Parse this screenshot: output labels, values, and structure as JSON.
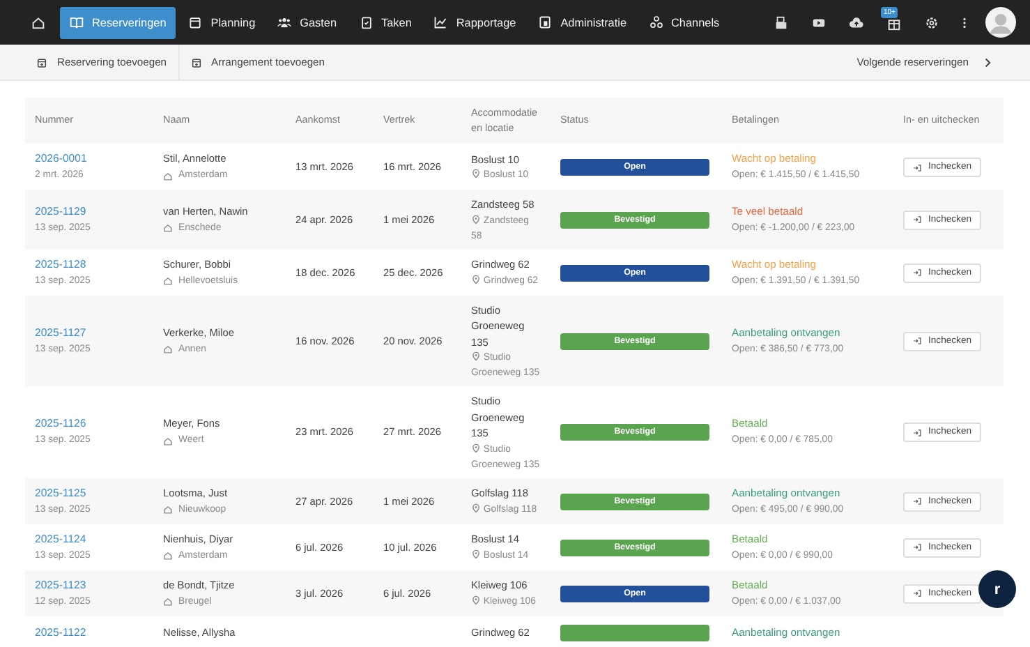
{
  "nav": {
    "items": [
      {
        "label": "Reserveringen",
        "selected": true
      },
      {
        "label": "Planning",
        "selected": false
      },
      {
        "label": "Gasten",
        "selected": false
      },
      {
        "label": "Taken",
        "selected": false
      },
      {
        "label": "Rapportage",
        "selected": false
      },
      {
        "label": "Administratie",
        "selected": false
      },
      {
        "label": "Channels",
        "selected": false
      }
    ],
    "badge": "10+"
  },
  "toolbar": {
    "actions": [
      "Reservering toevoegen",
      "Arrangement toevoegen"
    ],
    "next": "Volgende reserveringen"
  },
  "table": {
    "columns": [
      "Nummer",
      "Naam",
      "Aankomst",
      "Vertrek",
      "Accommodatie en locatie",
      "Status",
      "Betalingen",
      "In- en uitchecken"
    ],
    "rows": [
      {
        "number": "2026-0001",
        "date": "2 mrt. 2026",
        "name": "Stil, Annelotte",
        "city": "Amsterdam",
        "arrival": "13 mrt. 2026",
        "departure": "16 mrt. 2026",
        "accommodation": "Boslust 10",
        "location": "Boslust 10",
        "status": {
          "kind": "open",
          "label": "Open"
        },
        "payment": {
          "kind": "waiting",
          "label": "Wacht op betaling",
          "detail": "Open: € 1.415,50 / € 1.415,50"
        },
        "action": "Inchecken"
      },
      {
        "number": "2025-1129",
        "date": "13 sep. 2025",
        "name": "van Herten, Nawin",
        "city": "Enschede",
        "arrival": "24 apr. 2026",
        "departure": "1 mei 2026",
        "accommodation": "Zandsteeg 58",
        "location": "Zandsteeg 58",
        "status": {
          "kind": "confirmed",
          "label": "Bevestigd"
        },
        "payment": {
          "kind": "overpaid",
          "label": "Te veel betaald",
          "detail": "Open: € -1.200,00 / € 223,00"
        },
        "action": "Inchecken"
      },
      {
        "number": "2025-1128",
        "date": "13 sep. 2025",
        "name": "Schurer, Bobbi",
        "city": "Hellevoetsluis",
        "arrival": "18 dec. 2026",
        "departure": "25 dec. 2026",
        "accommodation": "Grindweg 62",
        "location": "Grindweg 62",
        "status": {
          "kind": "open",
          "label": "Open"
        },
        "payment": {
          "kind": "waiting",
          "label": "Wacht op betaling",
          "detail": "Open: € 1.391,50 / € 1.391,50"
        },
        "action": "Inchecken"
      },
      {
        "number": "2025-1127",
        "date": "13 sep. 2025",
        "name": "Verkerke, Miloe",
        "city": "Annen",
        "arrival": "16 nov. 2026",
        "departure": "20 nov. 2026",
        "accommodation": "Studio Groeneweg 135",
        "location": "Studio Groeneweg 135",
        "status": {
          "kind": "confirmed",
          "label": "Bevestigd"
        },
        "payment": {
          "kind": "deposit",
          "label": "Aanbetaling ontvangen",
          "detail": "Open: € 386,50 / € 773,00"
        },
        "action": "Inchecken"
      },
      {
        "number": "2025-1126",
        "date": "13 sep. 2025",
        "name": "Meyer, Fons",
        "city": "Weert",
        "arrival": "23 mrt. 2026",
        "departure": "27 mrt. 2026",
        "accommodation": "Studio Groeneweg 135",
        "location": "Studio Groeneweg 135",
        "status": {
          "kind": "confirmed",
          "label": "Bevestigd"
        },
        "payment": {
          "kind": "paid",
          "label": "Betaald",
          "detail": "Open: € 0,00 / € 785,00"
        },
        "action": "Inchecken"
      },
      {
        "number": "2025-1125",
        "date": "13 sep. 2025",
        "name": "Lootsma, Just",
        "city": "Nieuwkoop",
        "arrival": "27 apr. 2026",
        "departure": "1 mei 2026",
        "accommodation": "Golfslag 118",
        "location": "Golfslag 118",
        "status": {
          "kind": "confirmed",
          "label": "Bevestigd"
        },
        "payment": {
          "kind": "deposit",
          "label": "Aanbetaling ontvangen",
          "detail": "Open: € 495,00 / € 990,00"
        },
        "action": "Inchecken"
      },
      {
        "number": "2025-1124",
        "date": "13 sep. 2025",
        "name": "Nienhuis, Diyar",
        "city": "Amsterdam",
        "arrival": "6 jul. 2026",
        "departure": "10 jul. 2026",
        "accommodation": "Boslust 14",
        "location": "Boslust 14",
        "status": {
          "kind": "confirmed",
          "label": "Bevestigd"
        },
        "payment": {
          "kind": "paid",
          "label": "Betaald",
          "detail": "Open: € 0,00 / € 990,00"
        },
        "action": "Inchecken"
      },
      {
        "number": "2025-1123",
        "date": "12 sep. 2025",
        "name": "de Bondt, Tjitze",
        "city": "Breugel",
        "arrival": "3 jul. 2026",
        "departure": "6 jul. 2026",
        "accommodation": "Kleiweg 106",
        "location": "Kleiweg 106",
        "status": {
          "kind": "open",
          "label": "Open"
        },
        "payment": {
          "kind": "paid",
          "label": "Betaald",
          "detail": "Open: € 0,00 / € 1.037,00"
        },
        "action": "Inchecken"
      },
      {
        "number": "2025-1122",
        "name": "Nelisse, Allysha",
        "accommodation": "Grindweg 62",
        "status": {
          "kind": "confirmed"
        },
        "payment": {
          "kind": "deposit",
          "label": "Aanbetaling ontvangen"
        }
      }
    ]
  },
  "chat_button": {
    "label": "r"
  }
}
